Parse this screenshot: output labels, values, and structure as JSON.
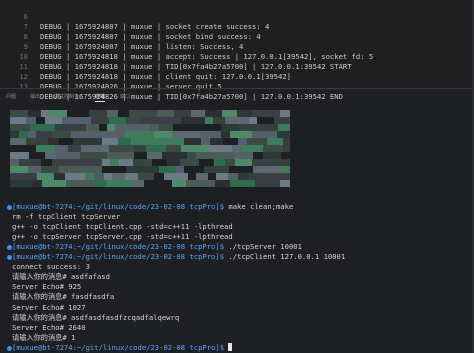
{
  "editor": {
    "lines": [
      {
        "num": "6",
        "text": "DEBUG | 1675924807 | muxue | socket create success: 4"
      },
      {
        "num": "7",
        "text": "DEBUG | 1675924807 | muxue | socket bind success: 4"
      },
      {
        "num": "8",
        "text": "DEBUG | 1675924807 | muxue | listen: Success, 4"
      },
      {
        "num": "9",
        "text": "DEBUG | 1675924818 | muxue | accept: Success | 127.0.0.1[39542], socket fd: 5"
      },
      {
        "num": "10",
        "text": "DEBUG | 1675924818 | muxue | TID[0x7fa4b27a5700] | 127.0.0.1:39542 START"
      },
      {
        "num": "11",
        "text": "DEBUG | 1675924818 | muxue | client quit: 127.0.0.1[39542]"
      },
      {
        "num": "12",
        "text": "DEBUG | 1675924826 | muxue | server quit 5"
      },
      {
        "num": "13",
        "text": "DEBUG | 1675924826 | muxue | TID[0x7fa4b27a5700] | 127.0.0.1:39542 END"
      },
      {
        "num": "14",
        "text": ""
      }
    ]
  },
  "panel": {
    "tabs": [
      "问题",
      "输出",
      "调试控制台",
      "终端",
      "端口"
    ],
    "active_tab": "终端"
  },
  "terminal": {
    "prompt_user": "[muxue@bt-7274:~/git/linux/code/23-02-08 tcpPro]$",
    "lines": [
      {
        "type": "prompt",
        "cmd": " make clean;make"
      },
      {
        "type": "out",
        "text": "rm -f tcpClient tcpServer"
      },
      {
        "type": "out",
        "text": "g++ -o tcpClient tcpClient.cpp -std=c++11 -lpthread"
      },
      {
        "type": "out",
        "text": "g++ -o tcpServer tcpServer.cpp -std=c++11 -lpthread"
      },
      {
        "type": "prompt",
        "cmd": " ./tcpServer 10001"
      },
      {
        "type": "prompt",
        "cmd": " ./tcpClient 127.0.0.1 10001"
      },
      {
        "type": "out",
        "text": "connect success: 3"
      },
      {
        "type": "out",
        "text": "请输入你的消息# asdfafasd"
      },
      {
        "type": "out",
        "text": "Server Echo# 925"
      },
      {
        "type": "out",
        "text": "请输入你的消息# fasdfasdfa"
      },
      {
        "type": "out",
        "text": "Server Echo# 1027"
      },
      {
        "type": "out",
        "text": "请输入你的消息# asdfasdfasdfzcqadfalqewrq"
      },
      {
        "type": "out",
        "text": "Server Echo# 2640"
      },
      {
        "type": "out",
        "text": "请输入你的消息# 1"
      },
      {
        "type": "prompt_cursor",
        "cmd": " "
      }
    ]
  },
  "colors": {
    "prompt_user": "#58a6ff",
    "marker": "#3f8ef7",
    "bg": "#1e1f22"
  }
}
